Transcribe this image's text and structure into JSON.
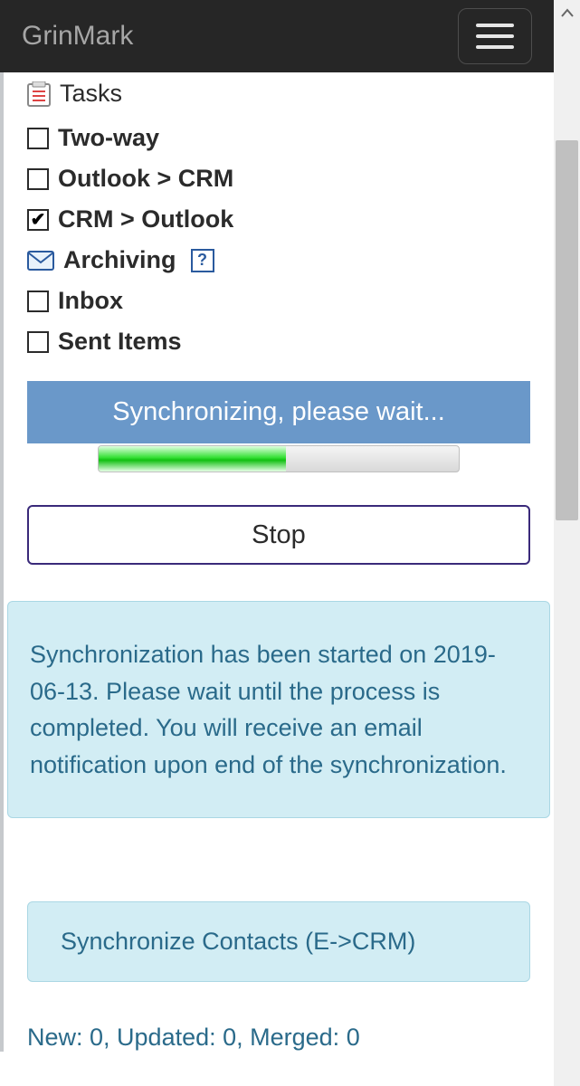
{
  "header": {
    "brand": "GrinMark"
  },
  "tasks": {
    "label": "Tasks"
  },
  "options": {
    "two_way": {
      "label": "Two-way",
      "checked": false
    },
    "o_to_crm": {
      "label": "Outlook > CRM",
      "checked": false
    },
    "crm_to_o": {
      "label": "CRM > Outlook",
      "checked": true
    }
  },
  "archiving": {
    "heading": "Archiving",
    "help": "?",
    "inbox": {
      "label": "Inbox",
      "checked": false
    },
    "sent": {
      "label": "Sent Items",
      "checked": false
    }
  },
  "sync": {
    "banner": "Synchronizing, please wait...",
    "stop_label": "Stop",
    "info": "Synchronization has been started on 2019-06-13. Please wait until the process is completed. You will receive an email notification upon end of the synchronization."
  },
  "job": {
    "title": "Synchronize Contacts (E->CRM)"
  },
  "counts_line": "New: 0, Updated: 0, Merged: 0"
}
